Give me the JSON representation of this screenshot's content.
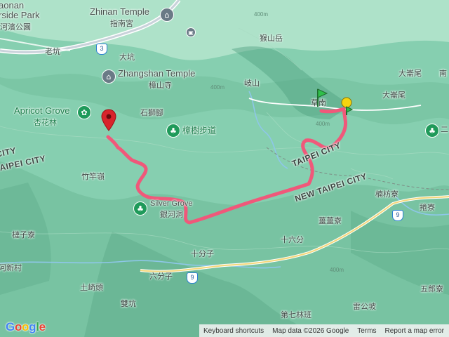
{
  "labels": {
    "aonan": "aonan",
    "riverside_park": "rside Park",
    "riverside_zh": "河濱公園",
    "zhinan_temple": "Zhinan Temple",
    "zhinan_zh": "指南宮",
    "houshanyue": "猴山岳",
    "laokeng": "老坑",
    "dakeng": "大坑",
    "zhangshan_temple": "Zhangshan Temple",
    "zhangshan_zh": "樟山寺",
    "qishan": "岐山",
    "apricot_grove": "Apricot Grove",
    "apricot_zh": "杏花林",
    "shishijiao": "石獅腳",
    "zhangshu_trail": "樟樹步道",
    "caonan": "草南",
    "dachaiwei1": "大崙尾",
    "dachaiwei2": "大崙尾",
    "nan": "南",
    "er": "二",
    "taipei_city_1": "TAIPEI CITY",
    "taipei_city_2": "TAIPEI CITY",
    "taipei_city_3": "CITY",
    "new_taipei_city": "NEW TAIPEI CITY",
    "zhuganling": "竹竿嶺",
    "silver_grove": "Silver Grove",
    "yinhedong": "銀河洞",
    "nanfangliao": "楠枋寮",
    "juanliao": "捲寮",
    "weiliao": "薑薑寮",
    "shiliufen": "十六分",
    "shifenzi": "十分子",
    "liufenzi": "六分子",
    "tuqitou": "土崎頭",
    "shuangkeng": "雙坑",
    "diqilinban": "第七林班",
    "dangongpo": "雷公坡",
    "wulangliao": "五郎寮",
    "lianziliao": "槤子寮",
    "hexincun": "河新村",
    "contour_400a": "400m",
    "contour_400b": "400m",
    "contour_400c": "400m",
    "contour_400d": "400m"
  },
  "shields": {
    "road3": "3",
    "road9a": "9",
    "road9b": "9"
  },
  "icons": {
    "temple_icon": "temple-icon",
    "zhangshan_icon": "temple-icon",
    "flower_icon": "flower-icon",
    "tree_icon": "tree-icon",
    "tree_icon2": "tree-icon",
    "tree_icon3": "tree-icon",
    "bus_icon": "bus-icon"
  },
  "route": {
    "color": "#f0587a"
  },
  "markers": {
    "end_color": "#d8242c",
    "start_color": "#2fbf4a",
    "waypoint_color": "#f5d40f"
  },
  "footer": {
    "logo": "Google",
    "shortcuts": "Keyboard shortcuts",
    "map_data": "Map data ©2026 Google",
    "terms": "Terms",
    "report": "Report a map error"
  }
}
